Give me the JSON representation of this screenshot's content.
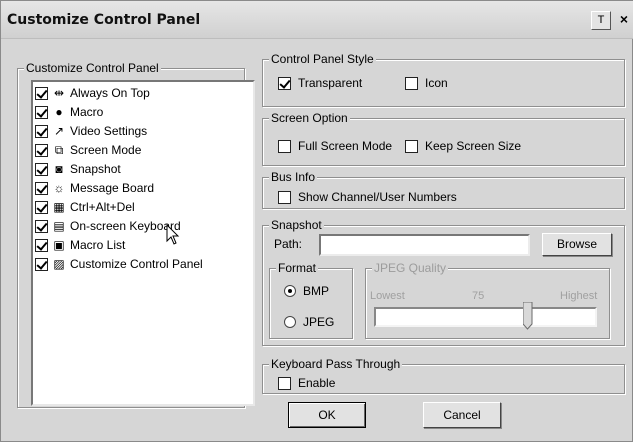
{
  "window": {
    "title": "Customize Control Panel",
    "pin_button": "T",
    "close_button": "×"
  },
  "left_panel": {
    "group_title": "Customize Control Panel",
    "items": [
      {
        "label": "Always On Top",
        "checked": true,
        "icon": "pin-icon",
        "glyph": "⇹"
      },
      {
        "label": "Macro",
        "checked": true,
        "icon": "macro-icon",
        "glyph": "●"
      },
      {
        "label": "Video Settings",
        "checked": true,
        "icon": "wrench-icon",
        "glyph": "↗"
      },
      {
        "label": "Screen Mode",
        "checked": true,
        "icon": "screen-mode-icon",
        "glyph": "⧉"
      },
      {
        "label": "Snapshot",
        "checked": true,
        "icon": "camera-icon",
        "glyph": "◙"
      },
      {
        "label": "Message Board",
        "checked": true,
        "icon": "sun-icon",
        "glyph": "☼"
      },
      {
        "label": "Ctrl+Alt+Del",
        "checked": true,
        "icon": "keys-icon",
        "glyph": "▦"
      },
      {
        "label": "On-screen Keyboard",
        "checked": true,
        "icon": "keyboard-icon",
        "glyph": "▤"
      },
      {
        "label": "Macro List",
        "checked": true,
        "icon": "document-icon",
        "glyph": "▣"
      },
      {
        "label": "Customize Control Panel",
        "checked": true,
        "icon": "panel-icon",
        "glyph": "▨"
      }
    ]
  },
  "style_group": {
    "title": "Control Panel Style",
    "transparent": {
      "label": "Transparent",
      "checked": true
    },
    "icon": {
      "label": "Icon",
      "checked": false
    }
  },
  "screen_group": {
    "title": "Screen Option",
    "full_screen": {
      "label": "Full Screen Mode",
      "checked": false
    },
    "keep_size": {
      "label": "Keep Screen Size",
      "checked": false
    }
  },
  "bus_group": {
    "title": "Bus Info",
    "show_numbers": {
      "label": "Show Channel/User Numbers",
      "checked": false
    }
  },
  "snapshot_group": {
    "title": "Snapshot",
    "path_label": "Path:",
    "path_value": "",
    "browse_label": "Browse",
    "format": {
      "title": "Format",
      "options": [
        "BMP",
        "JPEG"
      ],
      "selected": "BMP"
    },
    "jpeg_quality": {
      "title": "JPEG Quality",
      "low_label": "Lowest",
      "value": "75",
      "high_label": "Highest",
      "enabled": false
    }
  },
  "keyboard_group": {
    "title": "Keyboard Pass Through",
    "enable": {
      "label": "Enable",
      "checked": false
    }
  },
  "buttons": {
    "ok": "OK",
    "cancel": "Cancel"
  }
}
